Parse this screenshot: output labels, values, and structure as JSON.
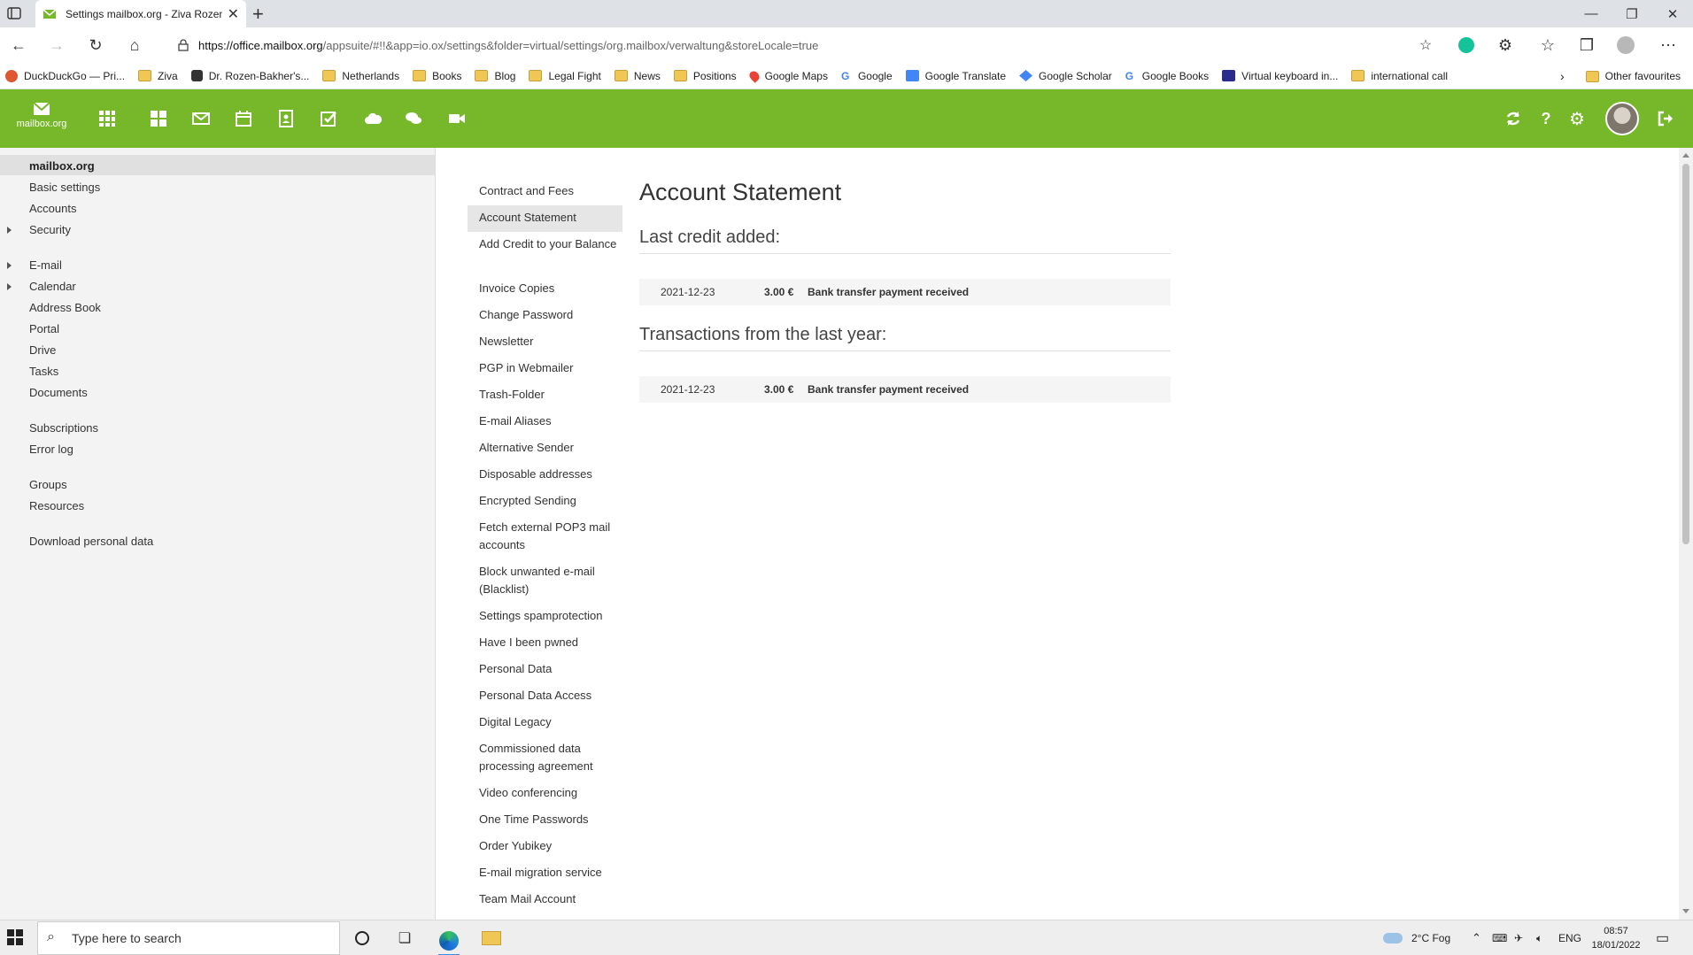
{
  "browser": {
    "tab_title": "Settings mailbox.org - Ziva Rozen-",
    "url_host": "https://office.mailbox.org",
    "url_rest": "/appsuite/#!!&app=io.ox/settings&folder=virtual/settings/org.mailbox/verwaltung&storeLocale=true",
    "bookmarks": [
      "DuckDuckGo — Pri...",
      "Ziva",
      "Dr. Rozen-Bakher's...",
      "Netherlands",
      "Books",
      "Blog",
      "Legal Fight",
      "News",
      "Positions",
      "Google Maps",
      "Google",
      "Google Translate",
      "Google Scholar",
      "Google Books",
      "Virtual keyboard in...",
      "international call"
    ],
    "other_favourites": "Other favourites"
  },
  "app": {
    "logo_text": "mailbox.org",
    "brand_color": "#76b82a"
  },
  "tree": {
    "items": [
      {
        "label": "mailbox.org"
      },
      {
        "label": "Basic settings"
      },
      {
        "label": "Accounts"
      },
      {
        "label": "Security"
      },
      {
        "label": "E-mail"
      },
      {
        "label": "Calendar"
      },
      {
        "label": "Address Book"
      },
      {
        "label": "Portal"
      },
      {
        "label": "Drive"
      },
      {
        "label": "Tasks"
      },
      {
        "label": "Documents"
      },
      {
        "label": "Subscriptions"
      },
      {
        "label": "Error log"
      },
      {
        "label": "Groups"
      },
      {
        "label": "Resources"
      },
      {
        "label": "Download personal data"
      }
    ]
  },
  "menu": {
    "items": [
      {
        "label": "Contract and Fees"
      },
      {
        "label": "Account Statement"
      },
      {
        "label": "Add Credit to your Balance"
      },
      {
        "label": "Invoice Copies"
      },
      {
        "label": "Change Password"
      },
      {
        "label": "Newsletter"
      },
      {
        "label": "PGP in Webmailer"
      },
      {
        "label": "Trash-Folder"
      },
      {
        "label": "E-mail Aliases"
      },
      {
        "label": "Alternative Sender"
      },
      {
        "label": "Disposable addresses"
      },
      {
        "label": "Encrypted Sending"
      },
      {
        "label": "Fetch external POP3 mail accounts"
      },
      {
        "label": "Block unwanted e-mail (Blacklist)"
      },
      {
        "label": "Settings spamprotection"
      },
      {
        "label": "Have I been pwned"
      },
      {
        "label": "Personal Data"
      },
      {
        "label": "Personal Data Access"
      },
      {
        "label": "Digital Legacy"
      },
      {
        "label": "Commissioned data processing agreement"
      },
      {
        "label": "Video conferencing"
      },
      {
        "label": "One Time Passwords"
      },
      {
        "label": "Order Yubikey"
      },
      {
        "label": "E-mail migration service"
      },
      {
        "label": "Team Mail Account"
      }
    ]
  },
  "content": {
    "title": "Account Statement",
    "last_credit_heading": "Last credit added:",
    "last_credit": {
      "date": "2021-12-23",
      "amount": "3.00 €",
      "description": "Bank transfer payment received"
    },
    "transactions_heading": "Transactions from the last year:",
    "transactions": [
      {
        "date": "2021-12-23",
        "amount": "3.00 €",
        "description": "Bank transfer payment received"
      }
    ]
  },
  "taskbar": {
    "search_placeholder": "Type here to search",
    "weather": "2°C  Fog",
    "lang": "ENG",
    "time": "08:57",
    "date": "18/01/2022"
  }
}
